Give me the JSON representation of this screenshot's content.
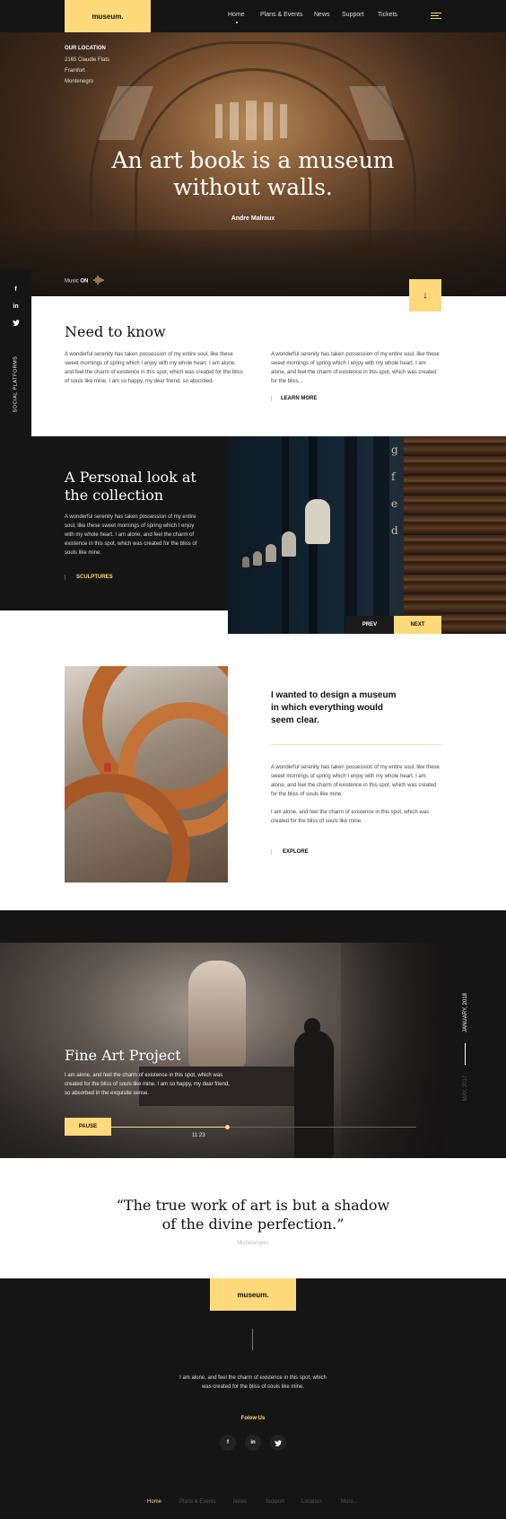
{
  "header": {
    "logo": "museum.",
    "nav": [
      "Home",
      "Plans & Events",
      "News",
      "Support",
      "Tickets"
    ]
  },
  "hero": {
    "location_label": "OUR LOCATION",
    "location_lines": [
      "2165 Claudie Flats",
      "Framfort",
      "Montenegro"
    ],
    "quote_line1": "An art book is a museum",
    "quote_line2": "without walls.",
    "author": "Andre Malraux",
    "music_label": "Music",
    "music_state": "ON"
  },
  "social": {
    "label": "SOCIAL PLATFORMS",
    "icons": [
      "facebook-icon",
      "linkedin-icon",
      "twitter-icon"
    ]
  },
  "need_to_know": {
    "title": "Need to know",
    "col1": "A wonderful serenity has taken possession of my entire soul, like these sweet mornings of spring which I enjoy with my whole heart. I am alone, and feel the charm of existence in this spot, which was created for the bliss of souls like mine. I am so happy, my dear friend, so absorbed.",
    "col2": "A wonderful serenity has taken possession of my entire soul, like these sweet mornings of spring which I enjoy with my whole heart. I am alone, and feel the charm of existence in this spot, which was created for the bliss...",
    "learn_more": "LEARN MORE"
  },
  "collection": {
    "title_line1": "A Personal look at",
    "title_line2": "the collection",
    "text": "A wonderful serenity has taken possession of my entire soul, like these sweet mornings of spring which I enjoy with my whole heart. I am alone, and feel the charm of existence in this spot, which was created for the bliss of souls like mine.",
    "link": "SCULPTURES",
    "prev": "PREV",
    "next": "NEXT"
  },
  "design": {
    "quote": "I wanted to design a museum in which everything would seem clear.",
    "para1": "A wonderful serenity has taken possession of my entire soul, like these sweet mornings of spring which I enjoy with my whole heart. I am alone, and feel the charm of existence in this spot, which was created for the bliss of souls like mine.",
    "para2": "I am alone, and feel the charm of existence in this spot, which was created for the bliss of souls like mine.",
    "link": "EXPLORE"
  },
  "art_project": {
    "title": "Fine Art Project",
    "text": "I am alone, and feel the charm of existence in this spot, which was created for the bliss of souls like mine. I am so happy, my dear friend, so absorbed in the exquisite sense.",
    "pause": "PAUSE",
    "time": "11:23",
    "progress": 0.38,
    "date_active": "JANUARY, 2018",
    "date_inactive": "MAY, 2017"
  },
  "big_quote": {
    "line1": "“The true work of art is but a shadow",
    "line2": "of the divine perfection.”",
    "author": "Michelangelo"
  },
  "footer": {
    "logo": "museum.",
    "text_line1": "I am alone, and feel the charm of existence in this spot, which",
    "text_line2": "was created for the bliss of souls like mine.",
    "follow": "Folow Us",
    "social": [
      "f",
      "in",
      "t"
    ],
    "nav": [
      "Home",
      "Plans & Events",
      "News",
      "Support",
      "Location",
      "More..."
    ]
  },
  "colors": {
    "accent": "#ffd97a",
    "dark": "#151515"
  }
}
